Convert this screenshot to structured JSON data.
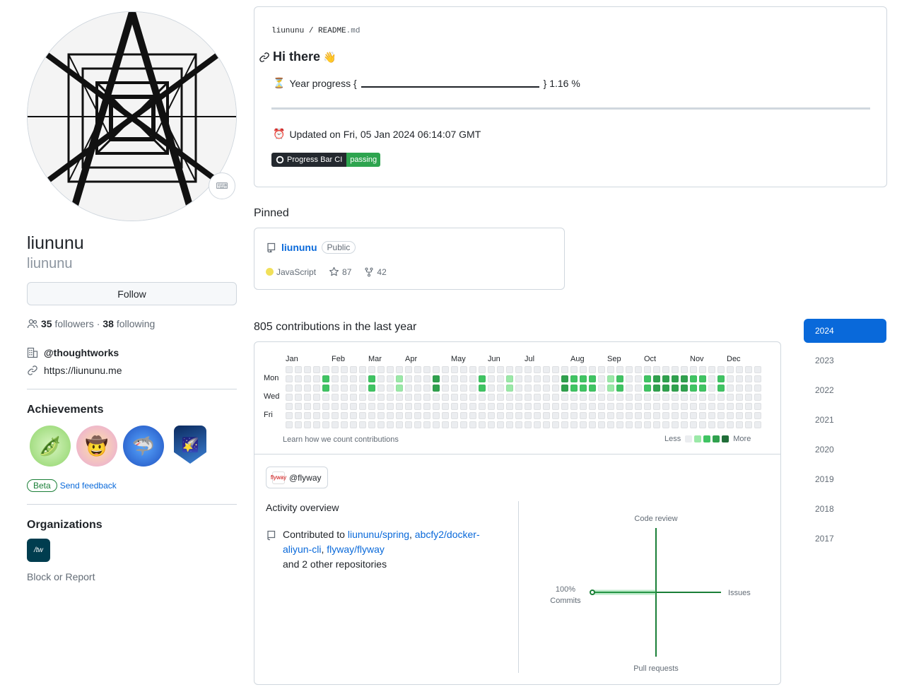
{
  "profile": {
    "name": "liununu",
    "login": "liununu",
    "follow_label": "Follow",
    "followers_count": "35",
    "followers_label": "followers",
    "following_count": "38",
    "following_label": "following",
    "separator": "·",
    "company": "@thoughtworks",
    "website": "https://liununu.me",
    "status_emoji": "⌨"
  },
  "achievements": {
    "heading": "Achievements",
    "badges": [
      {
        "name": "pair-extraordinaire",
        "glyph": "🫛"
      },
      {
        "name": "yolo",
        "glyph": "🤠"
      },
      {
        "name": "pull-shark",
        "glyph": "🦈"
      },
      {
        "name": "quickdraw",
        "glyph": "🌠"
      }
    ],
    "beta_label": "Beta",
    "feedback_label": "Send feedback"
  },
  "organizations": {
    "heading": "Organizations",
    "logo_text": "/tw"
  },
  "block_report": "Block or Report",
  "readme": {
    "path_user": "liununu",
    "path_sep": "/",
    "path_file": "README",
    "path_ext": ".md",
    "title": "Hi there",
    "title_emoji": "👋",
    "progress_prefix": "Year progress {",
    "progress_suffix": "} 1.16 %",
    "progress_value": 1.16,
    "progress_icon": "⏳",
    "updated_icon": "⏰",
    "updated_text": "Updated on Fri, 05 Jan 2024 06:14:07 GMT",
    "ci_label": "Progress Bar CI",
    "ci_status": "passing"
  },
  "pinned": {
    "heading": "Pinned",
    "repo_name": "liununu",
    "visibility": "Public",
    "language": "JavaScript",
    "language_color": "#f1e05a",
    "stars": "87",
    "forks": "42"
  },
  "contributions": {
    "heading": "805 contributions in the last year",
    "months": [
      "Jan",
      "Feb",
      "Mar",
      "Apr",
      "May",
      "Jun",
      "Jul",
      "Aug",
      "Sep",
      "Oct",
      "Nov",
      "Dec"
    ],
    "month_weeks": [
      0,
      5,
      9,
      13,
      18,
      22,
      26,
      31,
      35,
      39,
      44,
      48
    ],
    "days": [
      "Mon",
      "Wed",
      "Fri"
    ],
    "learn_text": "Learn how we count contributions",
    "legend_less": "Less",
    "legend_more": "More",
    "level_colors": [
      "#ebedf0",
      "#9be9a8",
      "#40c463",
      "#30a14e",
      "#216e39"
    ],
    "grid": [
      "0000000000000000000000000000000000000000000000000000",
      "0000200002001000300002001000003222012002333322020000",
      "0000200002001000300002001000003222012002333322020000",
      "0000000000000000000000000000000000000000000000000000",
      "0000000000000000000000000000000000000000000000000000",
      "0000000000000000000000000000000000000000000000000000",
      "0000000000000000000000000000000000000000000000000000"
    ],
    "org_filter": "@flyway",
    "org_filter_logo": "flyway",
    "activity_heading": "Activity overview",
    "contributed_prefix": "Contributed to",
    "repos": [
      "liununu/spring",
      "abcfy2/docker-aliyun-cli",
      "flyway/flyway"
    ],
    "repo_sep": ",",
    "and_more": "and 2 other repositories",
    "axis": {
      "top": "Code review",
      "right": "Issues",
      "bottom": "Pull requests",
      "left_percent": "100%",
      "left_label": "Commits"
    }
  },
  "years": [
    "2024",
    "2023",
    "2022",
    "2021",
    "2020",
    "2019",
    "2018",
    "2017"
  ],
  "active_year": "2024"
}
